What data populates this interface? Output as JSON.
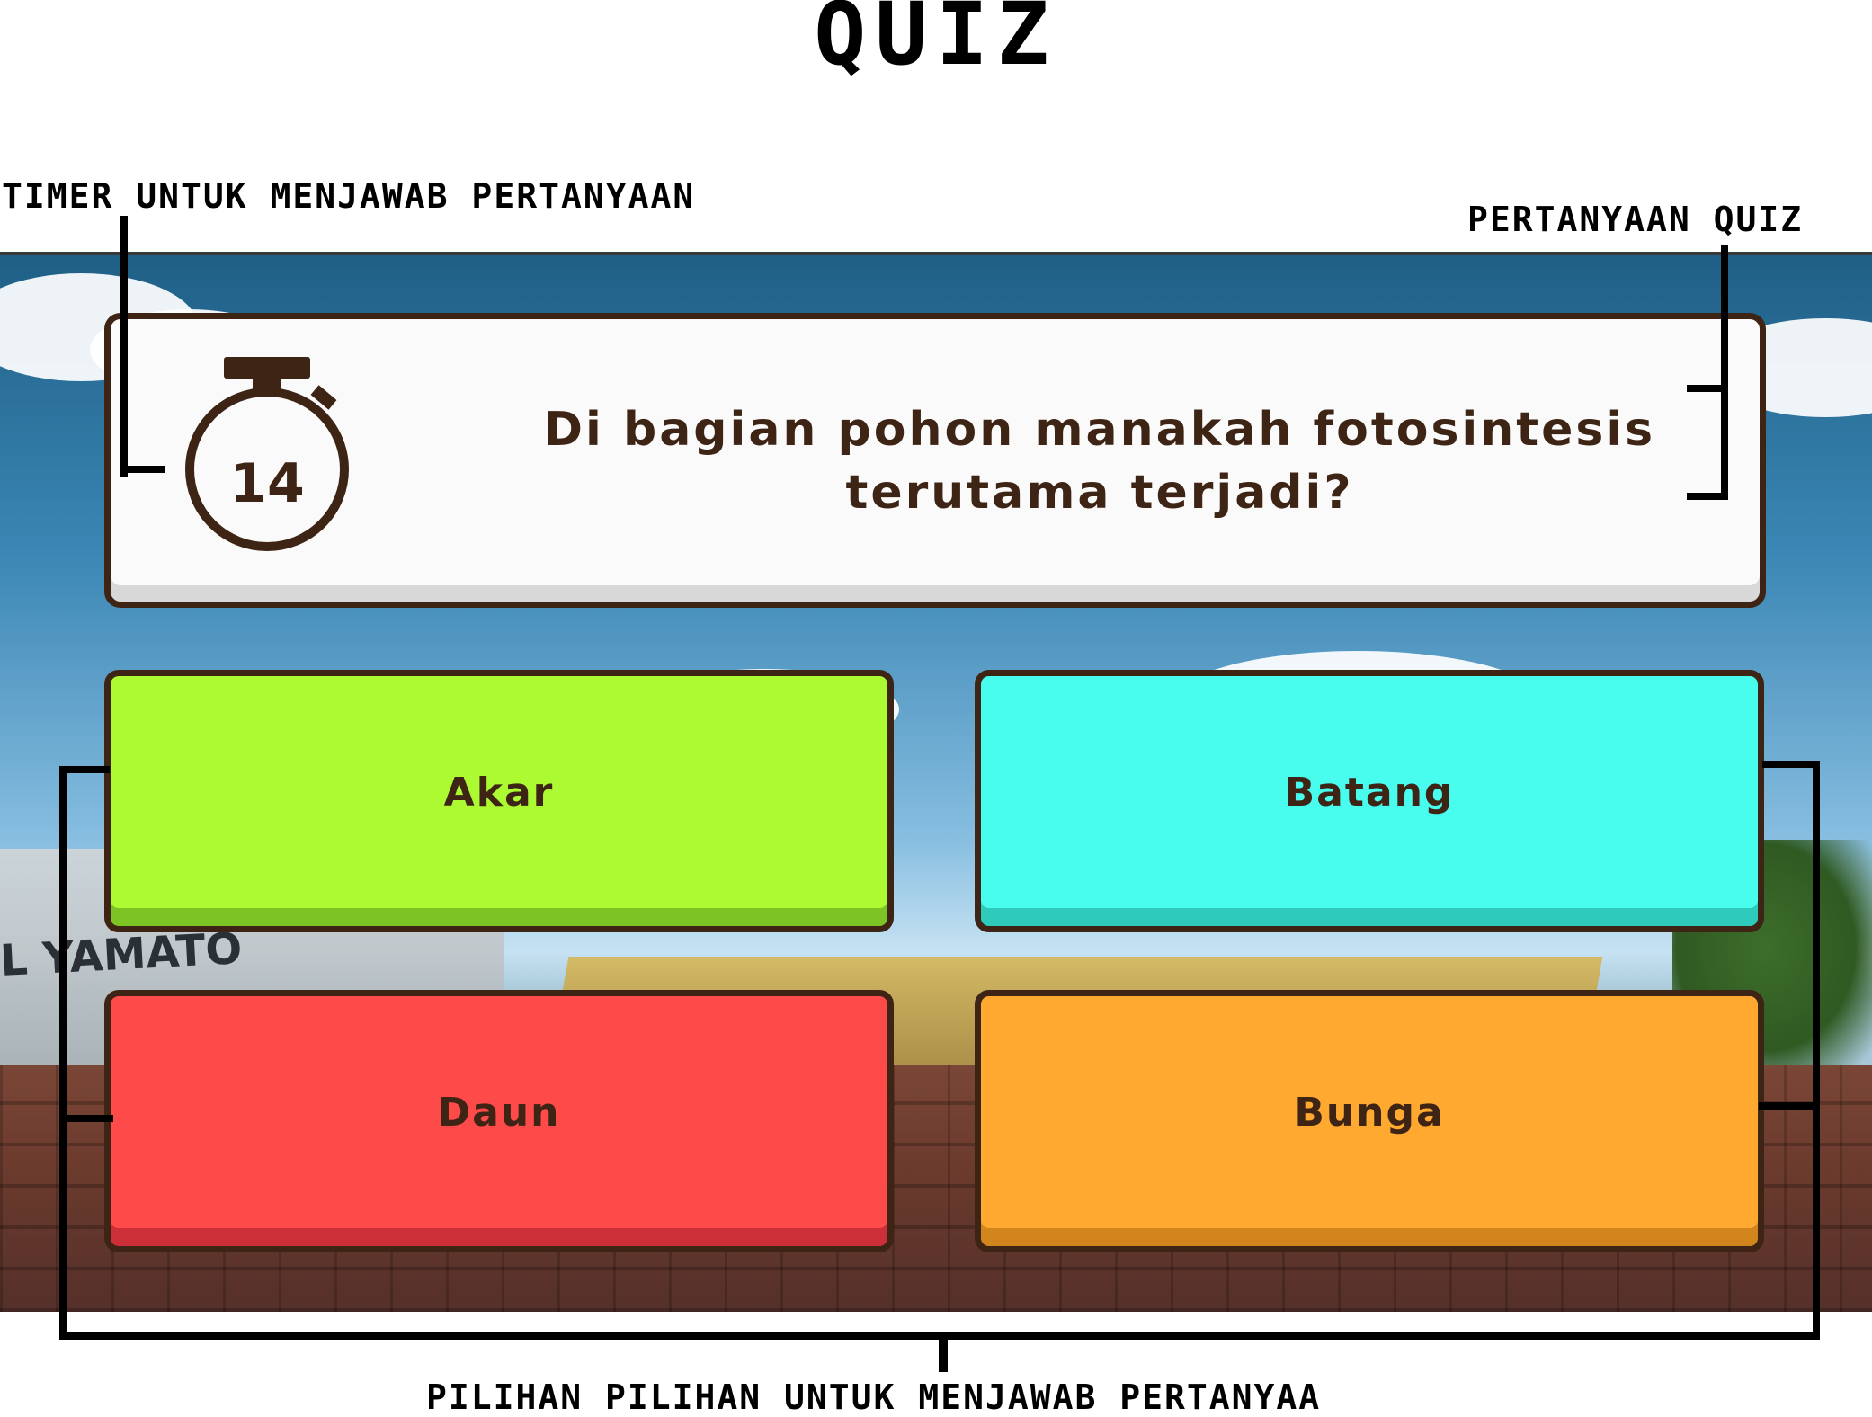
{
  "title": "QUIZ",
  "annotations": {
    "timer": "TIMER UNTUK MENJAWAB PERTANYAAN",
    "question": "PERTANYAAN QUIZ",
    "answers": "PILIHAN PILIHAN UNTUK MENJAWAB PERTANYAA"
  },
  "scene": {
    "sign_text": "L YAMATO"
  },
  "quiz": {
    "timer_value": "14",
    "question": "Di bagian pohon manakah fotosintesis terutama terjadi?",
    "answers": [
      {
        "label": "Akar",
        "color": "#acfa32",
        "shade": "#7cc324"
      },
      {
        "label": "Batang",
        "color": "#48fcee",
        "shade": "#2ecbbd"
      },
      {
        "label": "Daun",
        "color": "#ff4a4a",
        "shade": "#cc2f38"
      },
      {
        "label": "Bunga",
        "color": "#ffa930",
        "shade": "#d1851c"
      }
    ]
  },
  "colors": {
    "outline": "#3d2414",
    "annotation_lines": "#000000"
  }
}
